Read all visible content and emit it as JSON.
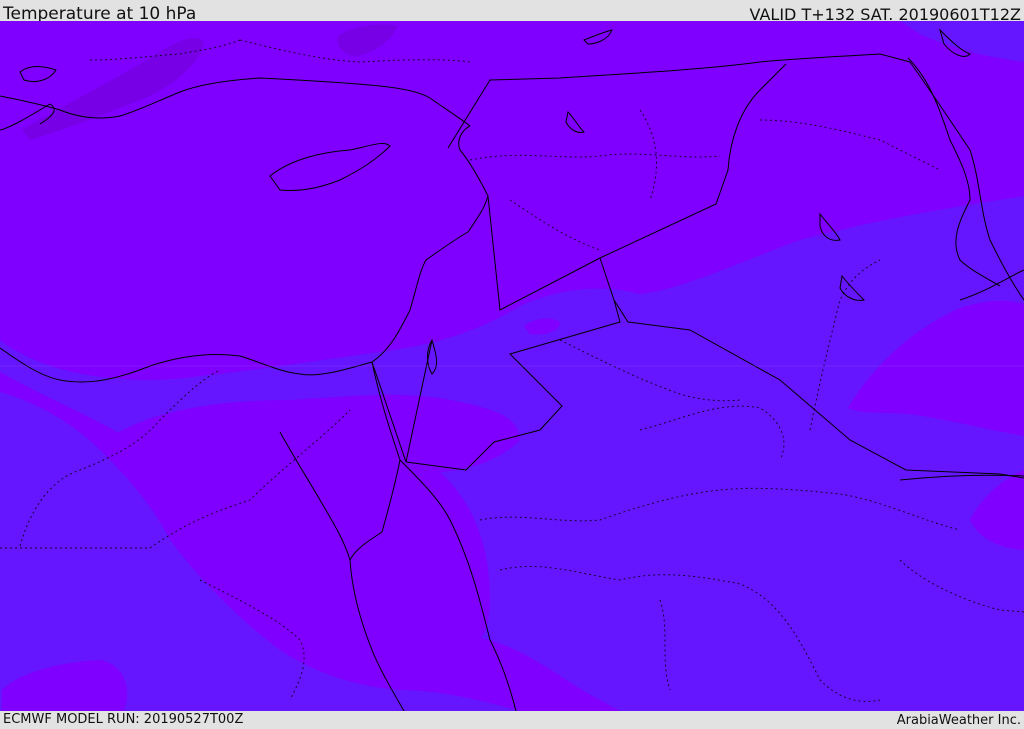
{
  "header": {
    "title": "Temperature at 10 hPa",
    "valid_time": "VALID T+132 SAT. 20190601T12Z"
  },
  "footer": {
    "model_run": "ECMWF MODEL RUN: 20190527T00Z",
    "credit": "ArabiaWeather Inc."
  },
  "map": {
    "field": "temperature",
    "level": "10 hPa",
    "fill_colors": {
      "warm_band": "#7f00ff",
      "cool_band": "#6616ff",
      "darkest_patch": "#7800e6"
    },
    "boundary_color": "#000000"
  }
}
